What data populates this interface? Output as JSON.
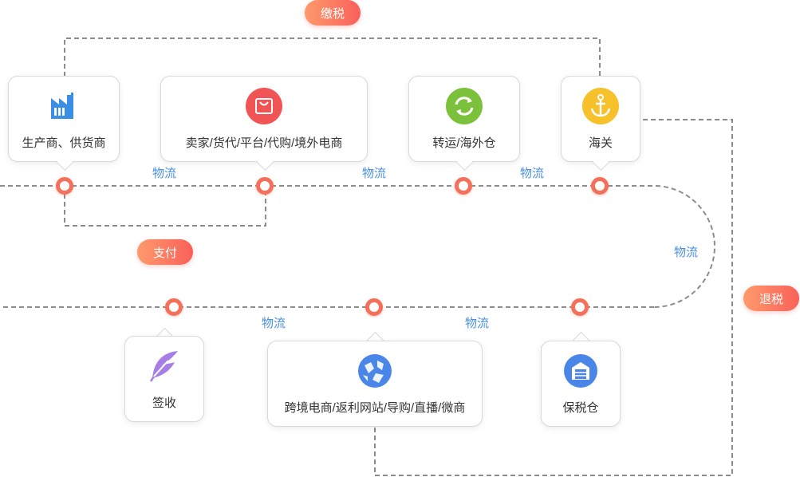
{
  "badges": {
    "tax_pay": "缴税",
    "payment": "支付",
    "tax_refund": "退税"
  },
  "cards": {
    "producer": "生产商、供货商",
    "seller": "卖家/货代/平台/代购/境外电商",
    "transit": "转运/海外仓",
    "customs": "海关",
    "receive": "签收",
    "crossborder": "跨境电商/返利网站/导购/直播/微商",
    "bonded": "保税仓"
  },
  "flow_labels": {
    "f1": "物流",
    "f2": "物流",
    "f3": "物流",
    "f4": "物流",
    "f5": "物流",
    "f6": "物流"
  },
  "colors": {
    "line": "#8c8c8c",
    "node": "#f5705a",
    "flow_text": "#4a90e2",
    "badge_start": "#ff9a6c",
    "badge_end": "#f9605a"
  },
  "icons": {
    "producer": "factory-icon",
    "seller": "shopping-bag-icon",
    "transit": "recycle-arrows-icon",
    "customs": "anchor-icon",
    "receive": "feather-pen-icon",
    "crossborder": "globe-icon",
    "bonded": "warehouse-icon"
  }
}
